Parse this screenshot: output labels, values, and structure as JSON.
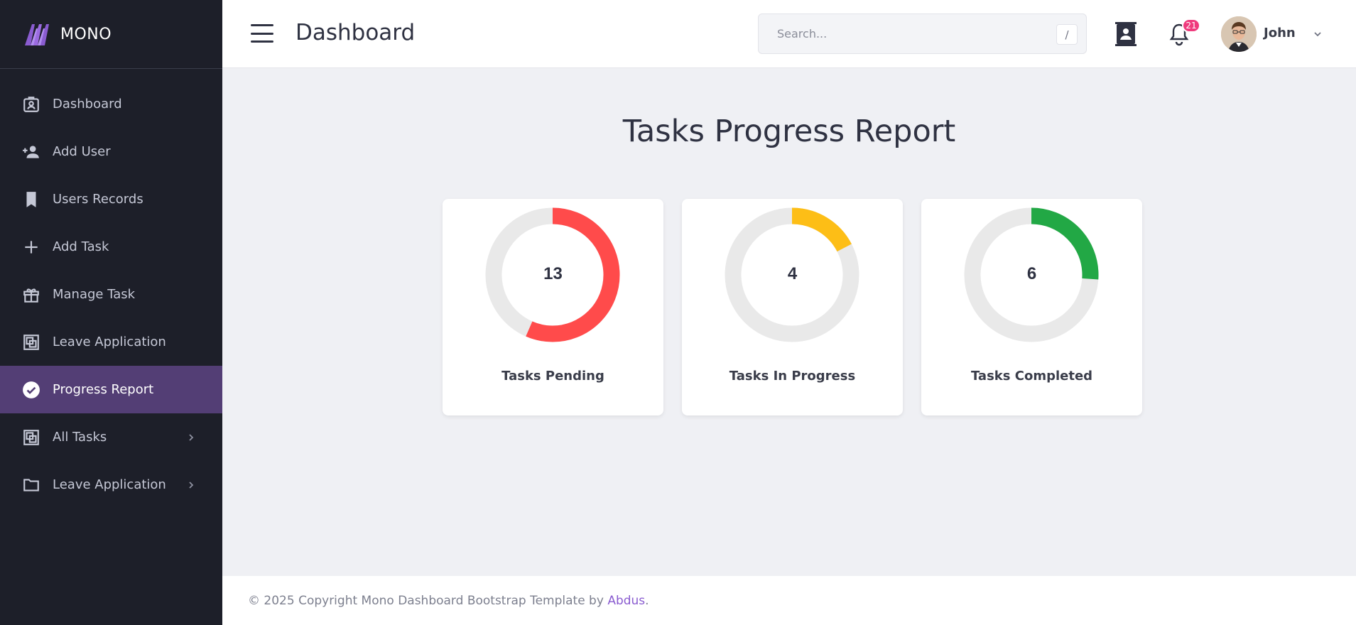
{
  "brand": {
    "name": "MONO",
    "logo": "mono-logo"
  },
  "sidebar": {
    "items": [
      {
        "label": "Dashboard",
        "icon": "badge-icon"
      },
      {
        "label": "Add User",
        "icon": "add-user-icon"
      },
      {
        "label": "Users Records",
        "icon": "bookmark-icon"
      },
      {
        "label": "Add Task",
        "icon": "plus-icon"
      },
      {
        "label": "Manage Task",
        "icon": "gift-icon"
      },
      {
        "label": "Leave Application",
        "icon": "layers-icon"
      },
      {
        "label": "Progress Report",
        "icon": "check-circle-icon",
        "active": true
      },
      {
        "label": "All Tasks",
        "icon": "layers-icon",
        "expandable": true
      },
      {
        "label": "Leave Application",
        "icon": "folder-icon",
        "expandable": true
      }
    ]
  },
  "header": {
    "title": "Dashboard",
    "search_placeholder": "Search...",
    "search_shortcut": "/",
    "notifications_count": "21",
    "user_name": "John"
  },
  "main": {
    "title": "Tasks Progress Report",
    "cards": [
      {
        "label": "Tasks Pending",
        "value": "13",
        "color": "#ff4b4b"
      },
      {
        "label": "Tasks In Progress",
        "value": "4",
        "color": "#fdbe16"
      },
      {
        "label": "Tasks Completed",
        "value": "6",
        "color": "#22a845"
      }
    ]
  },
  "chart_data": {
    "type": "pie",
    "categories": [
      "Tasks Pending",
      "Tasks In Progress",
      "Tasks Completed"
    ],
    "values": [
      13,
      4,
      6
    ],
    "total": 23,
    "colors": [
      "#ff4b4b",
      "#fdbe16",
      "#22a845"
    ],
    "track_color": "#e9e9e9"
  },
  "footer": {
    "text": "© 2025 Copyright Mono Dashboard Bootstrap Template by ",
    "link": "Abdus",
    "suffix": "."
  },
  "colors": {
    "sidebar_bg": "#1d1f29",
    "sidebar_active": "#533e75",
    "accent": "#8a5cd0",
    "badge": "#ef3b7d"
  }
}
